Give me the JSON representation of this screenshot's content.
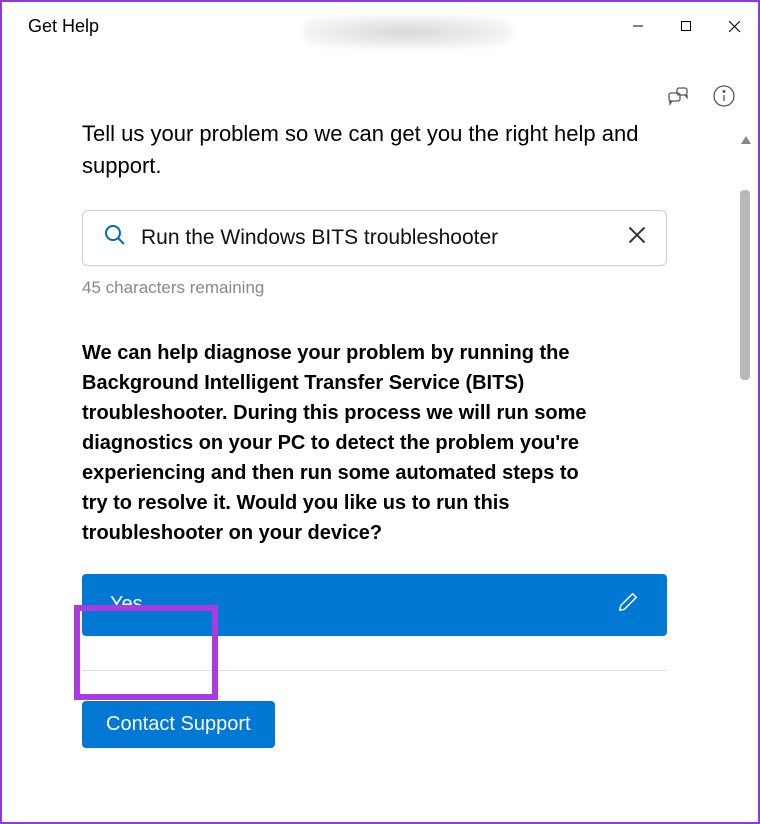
{
  "window": {
    "title": "Get Help"
  },
  "prompt": "Tell us your problem so we can get you the right help and support.",
  "search": {
    "value": "Run the Windows BITS troubleshooter"
  },
  "chars_remaining": "45 characters remaining",
  "diagnosis": "We can help diagnose your problem by running the Background Intelligent Transfer Service (BITS) troubleshooter. During this process we will run some diagnostics on your PC to detect the problem you're experiencing and then run some automated steps to try to resolve it. Would you like us to run this troubleshooter on your device?",
  "yes_label": "Yes",
  "contact_label": "Contact Support"
}
